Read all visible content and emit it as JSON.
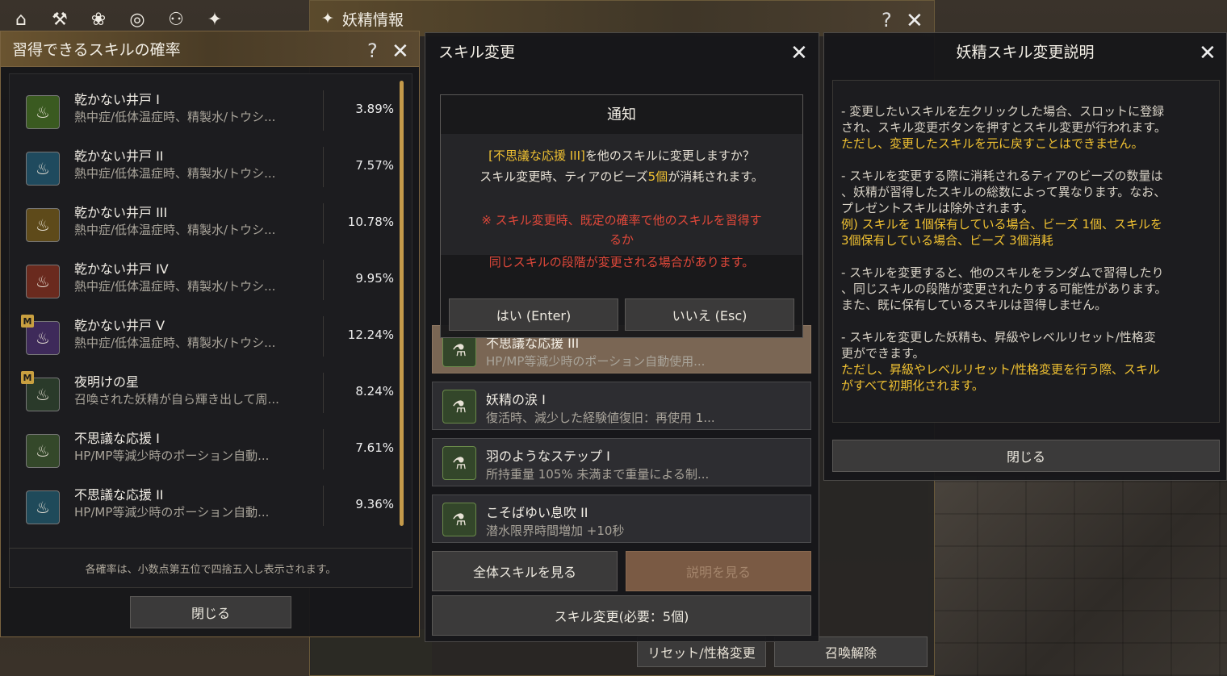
{
  "topbar": {
    "icons": [
      "home-icon",
      "pickaxe-icon",
      "paw-icon",
      "compass-icon",
      "group-icon",
      "butterfly-icon"
    ]
  },
  "fairy_info": {
    "title": "妖精情報",
    "reset_label": "リセット/性格変更",
    "unsummon_label": "召喚解除"
  },
  "prob": {
    "title": "習得できるスキルの確率",
    "rows": [
      {
        "name": "乾かない井戸 I",
        "desc": "熱中症/低体温症時、精製水/トウシ...",
        "pct": "3.89%",
        "color": "#3a5a20",
        "badge": ""
      },
      {
        "name": "乾かない井戸 II",
        "desc": "熱中症/低体温症時、精製水/トウシ...",
        "pct": "7.57%",
        "color": "#1f4a5e",
        "badge": ""
      },
      {
        "name": "乾かない井戸 III",
        "desc": "熱中症/低体温症時、精製水/トウシ...",
        "pct": "10.78%",
        "color": "#5e4a1a",
        "badge": ""
      },
      {
        "name": "乾かない井戸 IV",
        "desc": "熱中症/低体温症時、精製水/トウシ...",
        "pct": "9.95%",
        "color": "#6a2a1e",
        "badge": ""
      },
      {
        "name": "乾かない井戸 V",
        "desc": "熱中症/低体温症時、精製水/トウシ...",
        "pct": "12.24%",
        "color": "#3e2a5a",
        "badge": "M"
      },
      {
        "name": "夜明けの星",
        "desc": "召喚された妖精が自ら輝き出して周...",
        "pct": "8.24%",
        "color": "#2a3a2a",
        "badge": "M"
      },
      {
        "name": "不思議な応援 I",
        "desc": "HP/MP等減少時のポーション自動...",
        "pct": "7.61%",
        "color": "#34482a",
        "badge": ""
      },
      {
        "name": "不思議な応援 II",
        "desc": "HP/MP等減少時のポーション自動...",
        "pct": "9.36%",
        "color": "#1f4a5a",
        "badge": ""
      }
    ],
    "note": "各確率は、小数点第五位で四捨五入し表示されます。",
    "close_label": "閉じる"
  },
  "change": {
    "title": "スキル変更",
    "skills": [
      {
        "name": "不思議な応援 III",
        "desc": "HP/MP等減少時のポーション自動使用..."
      },
      {
        "name": "妖精の涙 I",
        "desc": "復活時、減少した経験値復旧：再使用 1..."
      },
      {
        "name": "羽のようなステップ I",
        "desc": "所持重量 105% 未満まで重量による制..."
      },
      {
        "name": "こそばゆい息吹 II",
        "desc": "潜水限界時間増加 +10秒"
      }
    ],
    "all_skills_label": "全体スキルを見る",
    "explain_label": "説明を見る",
    "change_label": "スキル変更(必要：5個)"
  },
  "notice": {
    "title": "通知",
    "line1_hl": "[不思議な応援 III]",
    "line1_rest": "を他のスキルに変更しますか？",
    "line2_a": "スキル変更時、ティアのビーズ",
    "line2_hl": "5個",
    "line2_b": "が消耗されます。",
    "warn1": "※ スキル変更時、既定の確率で他のスキルを習得す",
    "warn2": "るか",
    "warn3": "同じスキルの段階が変更される場合があります。",
    "yes_label": "はい (Enter)",
    "no_label": "いいえ (Esc)"
  },
  "explain": {
    "title": "妖精スキル変更説明",
    "p1a": "- 変更したいスキルを左クリックした場合、スロットに登録",
    "p1b": "され、スキル変更ボタンを押すとスキル変更が行われます。",
    "p1c": " ただし、変更したスキルを元に戻すことはできません。",
    "p2a": "- スキルを変更する際に消耗されるティアのビーズの数量は",
    "p2b": "、妖精が習得したスキルの総数によって異なります。なお、",
    "p2c": "プレゼントスキルは除外されます。",
    "p2d": "例) スキルを 1個保有している場合、ビーズ 1個、スキルを",
    "p2e": "3個保有している場合、ビーズ 3個消耗",
    "p3a": "- スキルを変更すると、他のスキルをランダムで習得したり",
    "p3b": "、同じスキルの段階が変更されたりする可能性があります。",
    "p3c": "また、既に保有しているスキルは習得しません。",
    "p4a": "- スキルを変更した妖精も、昇級やレベルリセット/性格変",
    "p4b": "更ができます。",
    "p4c": " ただし、昇級やレベルリセット/性格変更を行う際、スキル",
    "p4d": "がすべて初期化されます。",
    "close_label": "閉じる"
  },
  "colors": {
    "accent": "#f1c232",
    "warn": "#e0483a",
    "gold": "#c49a4a"
  }
}
